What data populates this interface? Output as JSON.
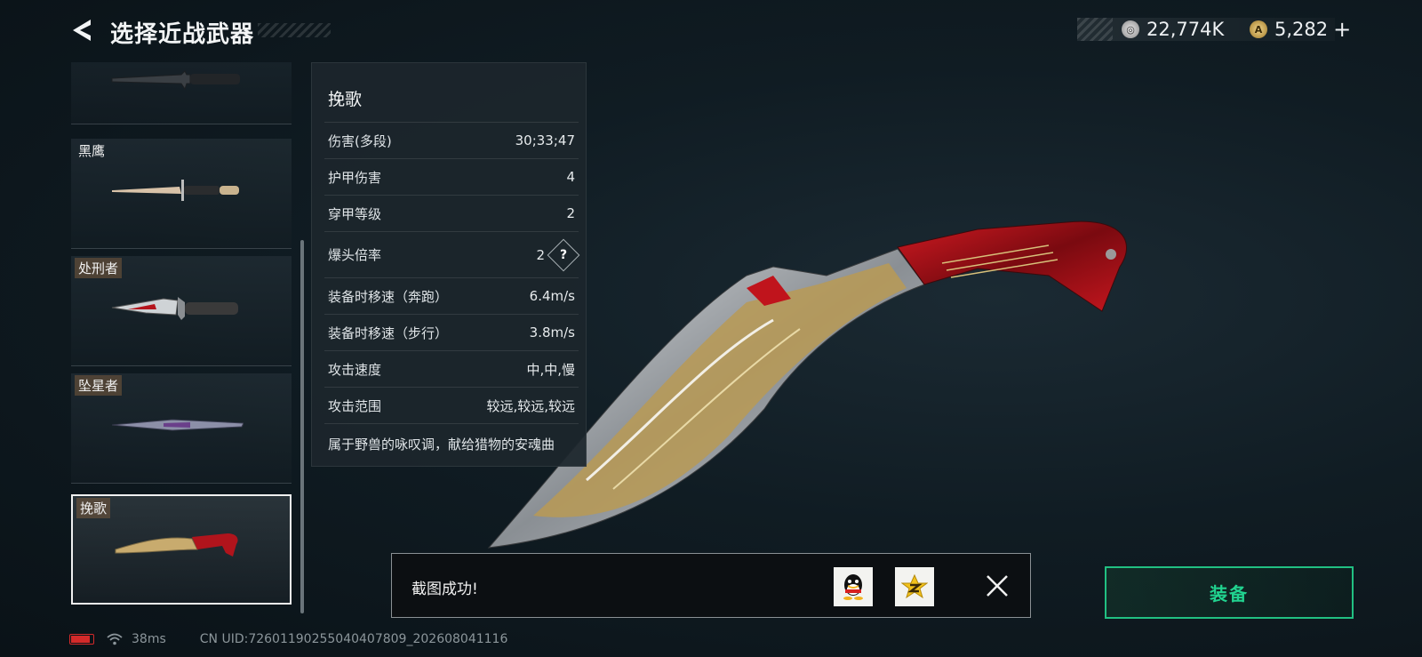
{
  "header": {
    "title": "选择近战武器",
    "currency": [
      {
        "icon": "silver-coin-icon",
        "value": "22,774K"
      },
      {
        "icon": "gold-coin-icon",
        "value": "5,282"
      }
    ],
    "add_label": "+"
  },
  "weapons": [
    {
      "name": "",
      "tagged": false,
      "selected": false
    },
    {
      "name": "黑鹰",
      "tagged": false,
      "selected": false
    },
    {
      "name": "处刑者",
      "tagged": true,
      "selected": false
    },
    {
      "name": "坠星者",
      "tagged": true,
      "selected": false
    },
    {
      "name": "挽歌",
      "tagged": true,
      "selected": true
    }
  ],
  "stats": {
    "title": "挽歌",
    "rows": [
      {
        "label": "伤害(多段)",
        "value": "30;33;47"
      },
      {
        "label": "护甲伤害",
        "value": "4"
      },
      {
        "label": "穿甲等级",
        "value": "2"
      },
      {
        "label": "爆头倍率",
        "value": "2"
      },
      {
        "label": "装备时移速（奔跑）",
        "value": "6.4m/s"
      },
      {
        "label": "装备时移速（步行）",
        "value": "3.8m/s"
      },
      {
        "label": "攻击速度",
        "value": "中,中,慢"
      },
      {
        "label": "攻击范围",
        "value": "较远,较远,较远"
      }
    ],
    "help_label": "?",
    "description": "属于野兽的咏叹调，献给猎物的安魂曲"
  },
  "toast": {
    "message": "截图成功!",
    "share_icons": [
      "qq-icon",
      "qzone-icon"
    ],
    "close_icon": "close-icon"
  },
  "equip_button": {
    "label": "装备",
    "color": "#21d28f"
  },
  "status_bar": {
    "ping": "38ms",
    "uid": "CN UID:7260119025504040​7809_202608041116"
  }
}
